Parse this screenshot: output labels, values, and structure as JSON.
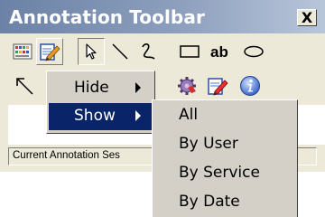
{
  "window": {
    "title": "Annotation Toolbar",
    "close_label": "X"
  },
  "toolbar_row1": [
    {
      "icon": "grid-palette-icon"
    },
    {
      "icon": "edit-document-icon"
    },
    {
      "icon": "select-arrow-icon"
    },
    {
      "icon": "line-icon"
    },
    {
      "icon": "freehand-icon"
    },
    {
      "icon": "rectangle-icon"
    },
    {
      "icon": "text-icon",
      "label": "ab"
    },
    {
      "icon": "ellipse-icon"
    }
  ],
  "toolbar_row2": [
    {
      "icon": "arrow-tool-icon"
    },
    {
      "icon": "settings-gear-icon"
    },
    {
      "icon": "edit-note-icon"
    },
    {
      "icon": "info-icon"
    }
  ],
  "status_bar": {
    "text": "Current Annotation Ses"
  },
  "context_menu": {
    "items": [
      {
        "label": "Hide"
      },
      {
        "label": "Show"
      }
    ]
  },
  "submenu": {
    "items": [
      {
        "label": "All"
      },
      {
        "label": "By User"
      },
      {
        "label": "By Service"
      },
      {
        "label": "By Date"
      }
    ]
  }
}
